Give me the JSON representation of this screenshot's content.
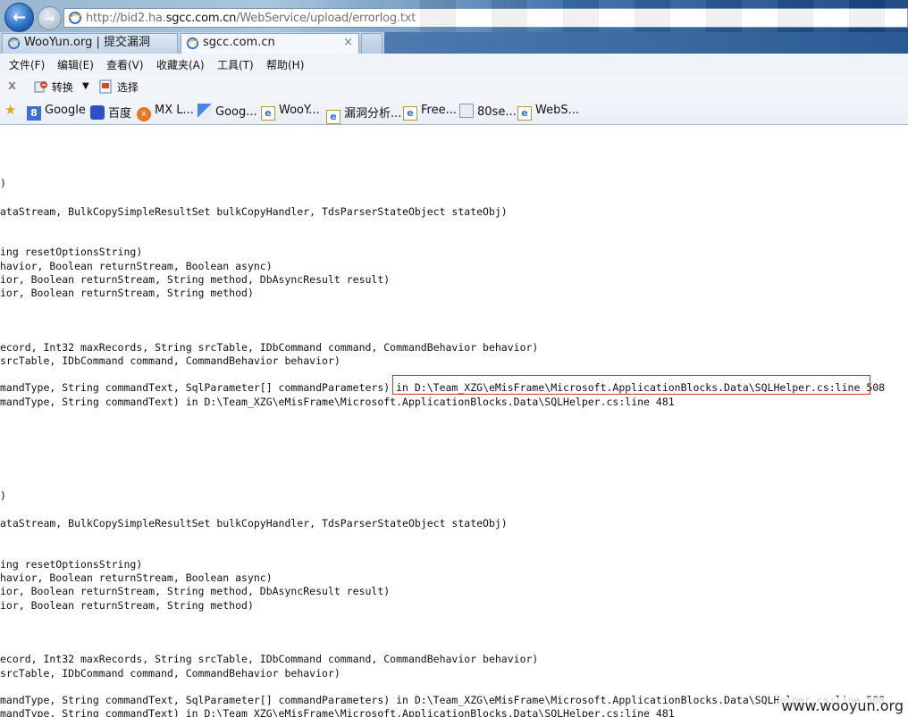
{
  "browser": {
    "url_prefix": "http://bid2.ha.",
    "url_domain": "sgcc.com.cn",
    "url_path": "/WebService/upload/errorlog.txt"
  },
  "tabs": [
    {
      "label": "WooYun.org | 提交漏洞"
    },
    {
      "label": "sgcc.com.cn",
      "close": "×"
    }
  ],
  "menu": [
    "文件(F)",
    "编辑(E)",
    "查看(V)",
    "收藏夹(A)",
    "工具(T)",
    "帮助(H)"
  ],
  "toolbar": {
    "close": "x",
    "convert_label": "转换",
    "dropdown": "▼",
    "select_label": "选择"
  },
  "favorites": [
    "Google",
    "百度",
    "MX L...",
    "Goog...",
    "WooY...",
    "漏洞分析...",
    "Free...",
    "80se...",
    "WebS..."
  ],
  "log_lines": [
    ")",
    "ataStream, BulkCopySimpleResultSet bulkCopyHandler, TdsParserStateObject stateObj)",
    "ing resetOptionsString)",
    "havior, Boolean returnStream, Boolean async)",
    "ior, Boolean returnStream, String method, DbAsyncResult result)",
    "ior, Boolean returnStream, String method)",
    "ecord, Int32 maxRecords, String srcTable, IDbCommand command, CommandBehavior behavior)",
    "srcTable, IDbCommand command, CommandBehavior behavior)",
    "mandType, String commandText, SqlParameter[] commandParameters) in D:\\Team_XZG\\eMisFrame\\Microsoft.ApplicationBlocks.Data\\SQLHelper.cs:line 508",
    "mandType, String commandText) in D:\\Team_XZG\\eMisFrame\\Microsoft.ApplicationBlocks.Data\\SQLHelper.cs:line 481",
    ")",
    "ataStream, BulkCopySimpleResultSet bulkCopyHandler, TdsParserStateObject stateObj)",
    "ing resetOptionsString)",
    "havior, Boolean returnStream, Boolean async)",
    "ior, Boolean returnStream, String method, DbAsyncResult result)",
    "ior, Boolean returnStream, String method)",
    "ecord, Int32 maxRecords, String srcTable, IDbCommand command, CommandBehavior behavior)",
    "srcTable, IDbCommand command, CommandBehavior behavior)",
    "mandType, String commandText, SqlParameter[] commandParameters) in D:\\Team_XZG\\eMisFrame\\Microsoft.ApplicationBlocks.Data\\SQLHelper.cs:line 508",
    "mandType, String commandText) in D:\\Team_XZG\\eMisFrame\\Microsoft.ApplicationBlocks.Data\\SQLHelper.cs:line 481"
  ],
  "watermark": "www.wooyun.org",
  "colors": {
    "highlight_border": "#d9352b"
  }
}
